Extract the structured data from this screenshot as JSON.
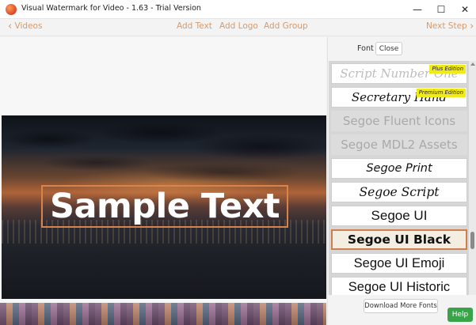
{
  "window": {
    "title": "Visual Watermark for Video - 1.63 - Trial Version",
    "minimize": "—",
    "maximize": "☐",
    "close": "✕"
  },
  "toolbar": {
    "back_label": "Videos",
    "add_text": "Add Text",
    "add_logo": "Add Logo",
    "add_group": "Add Group",
    "next_label": "Next Step"
  },
  "preview": {
    "watermark_text": "Sample Text"
  },
  "font_panel": {
    "label": "Font",
    "close_button": "Close",
    "fonts": [
      {
        "name": "Script Number One",
        "badge": "Plus Edition",
        "state": "normal"
      },
      {
        "name": "Secretary Hand",
        "badge": "Premium Edition",
        "state": "normal"
      },
      {
        "name": "Segoe Fluent Icons",
        "badge": "",
        "state": "disabled"
      },
      {
        "name": "Segoe MDL2 Assets",
        "badge": "",
        "state": "disabled"
      },
      {
        "name": "Segoe Print",
        "badge": "",
        "state": "normal"
      },
      {
        "name": "Segoe Script",
        "badge": "",
        "state": "normal"
      },
      {
        "name": "Segoe UI",
        "badge": "",
        "state": "normal"
      },
      {
        "name": "Segoe UI Black",
        "badge": "",
        "state": "selected"
      },
      {
        "name": "Segoe UI Emoji",
        "badge": "",
        "state": "normal"
      },
      {
        "name": "Segoe UI Historic",
        "badge": "",
        "state": "normal"
      }
    ],
    "download_button": "Download More Fonts",
    "help_button": "Help"
  },
  "colors": {
    "accent": "#d59a6c",
    "selection_border": "#cf7f4c",
    "badge": "#f1ea1a",
    "help": "#39a34a"
  }
}
